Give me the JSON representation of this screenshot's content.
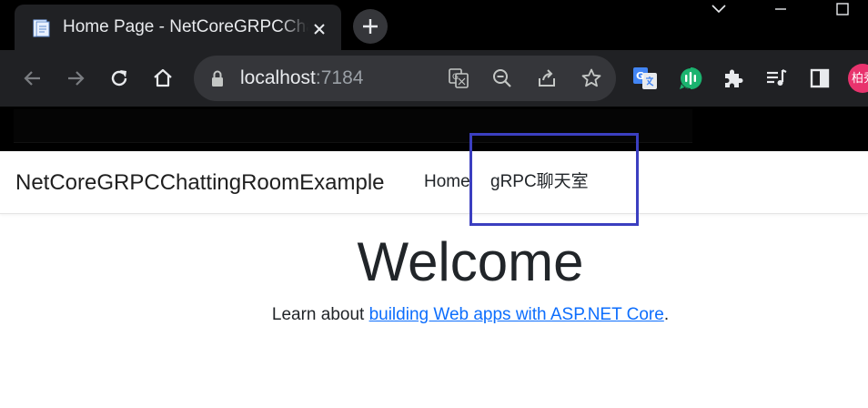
{
  "browser": {
    "tab": {
      "title": "Home Page - NetCoreGRPCChattingRoomExample"
    },
    "url": {
      "host": "localhost",
      "port": ":7184"
    },
    "avatar_text": "柏秀"
  },
  "site": {
    "brand": "NetCoreGRPCChattingRoomExample",
    "nav": [
      {
        "label": "Home"
      },
      {
        "label": "gRPC聊天室"
      }
    ]
  },
  "main": {
    "heading": "Welcome",
    "learn_prefix": "Learn about ",
    "learn_link": "building Web apps with ASP.NET Core",
    "learn_suffix": "."
  },
  "colors": {
    "highlight_border": "#3b3fc0",
    "link": "#0d6efd",
    "avatar_bg": "#e8336d"
  }
}
